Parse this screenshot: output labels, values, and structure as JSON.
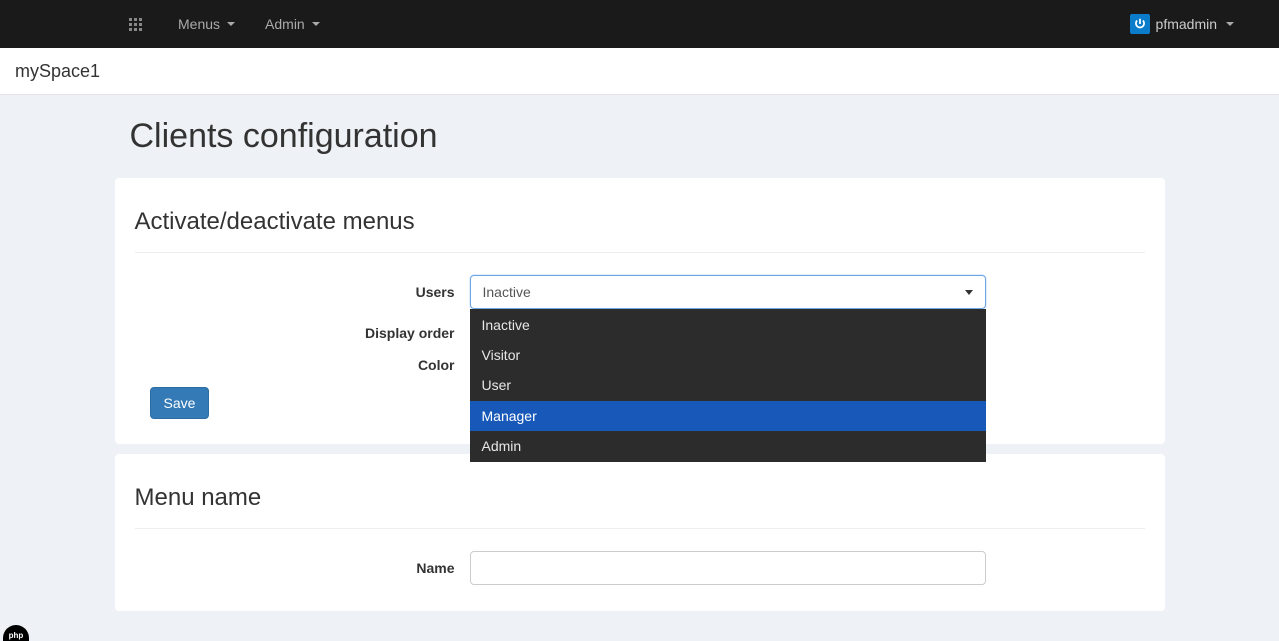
{
  "nav": {
    "menus": "Menus",
    "admin": "Admin",
    "username": "pfmadmin"
  },
  "breadcrumb": {
    "space": "mySpace1"
  },
  "page": {
    "title": "Clients configuration"
  },
  "panel1": {
    "heading": "Activate/deactivate menus",
    "labels": {
      "users": "Users",
      "display_order": "Display order",
      "color": "Color"
    },
    "users_select": {
      "selected": "Inactive",
      "options": [
        "Inactive",
        "Visitor",
        "User",
        "Manager",
        "Admin"
      ],
      "highlighted_index": 3
    },
    "save_button": "Save"
  },
  "panel2": {
    "heading": "Menu name",
    "labels": {
      "name": "Name"
    },
    "name_value": ""
  },
  "badge": {
    "text": "php"
  }
}
